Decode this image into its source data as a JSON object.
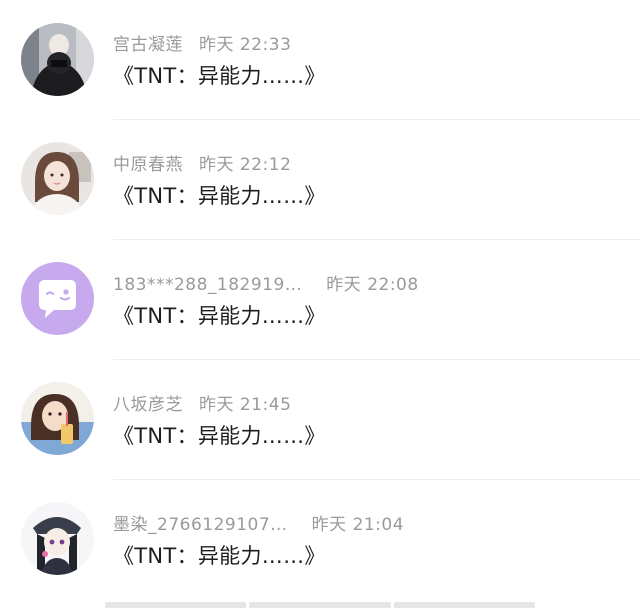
{
  "comments": [
    {
      "user": "宫古凝莲",
      "time": "昨天 22:33",
      "text": "《TNT：异能力……》",
      "avatar": "dark-hoodie-photo-avatar"
    },
    {
      "user": "中原春燕",
      "time": "昨天 22:12",
      "text": "《TNT：异能力……》",
      "avatar": "girl-photo-avatar"
    },
    {
      "user": "183***288_182919…",
      "time": "昨天 22:08",
      "text": "《TNT：异能力……》",
      "avatar": "default-purple-chat-avatar"
    },
    {
      "user": "八坂彦芝",
      "time": "昨天 21:45",
      "text": "《TNT：异能力……》",
      "avatar": "girl-drink-photo-avatar"
    },
    {
      "user": "墨染_2766129107…",
      "time": "昨天 21:04",
      "text": "《TNT：异能力……》",
      "avatar": "anime-girl-avatar"
    }
  ],
  "colors": {
    "meta_text": "#9a9a9a",
    "message_text": "#1e1e1e",
    "default_avatar_bg": "#c7a9ee"
  }
}
